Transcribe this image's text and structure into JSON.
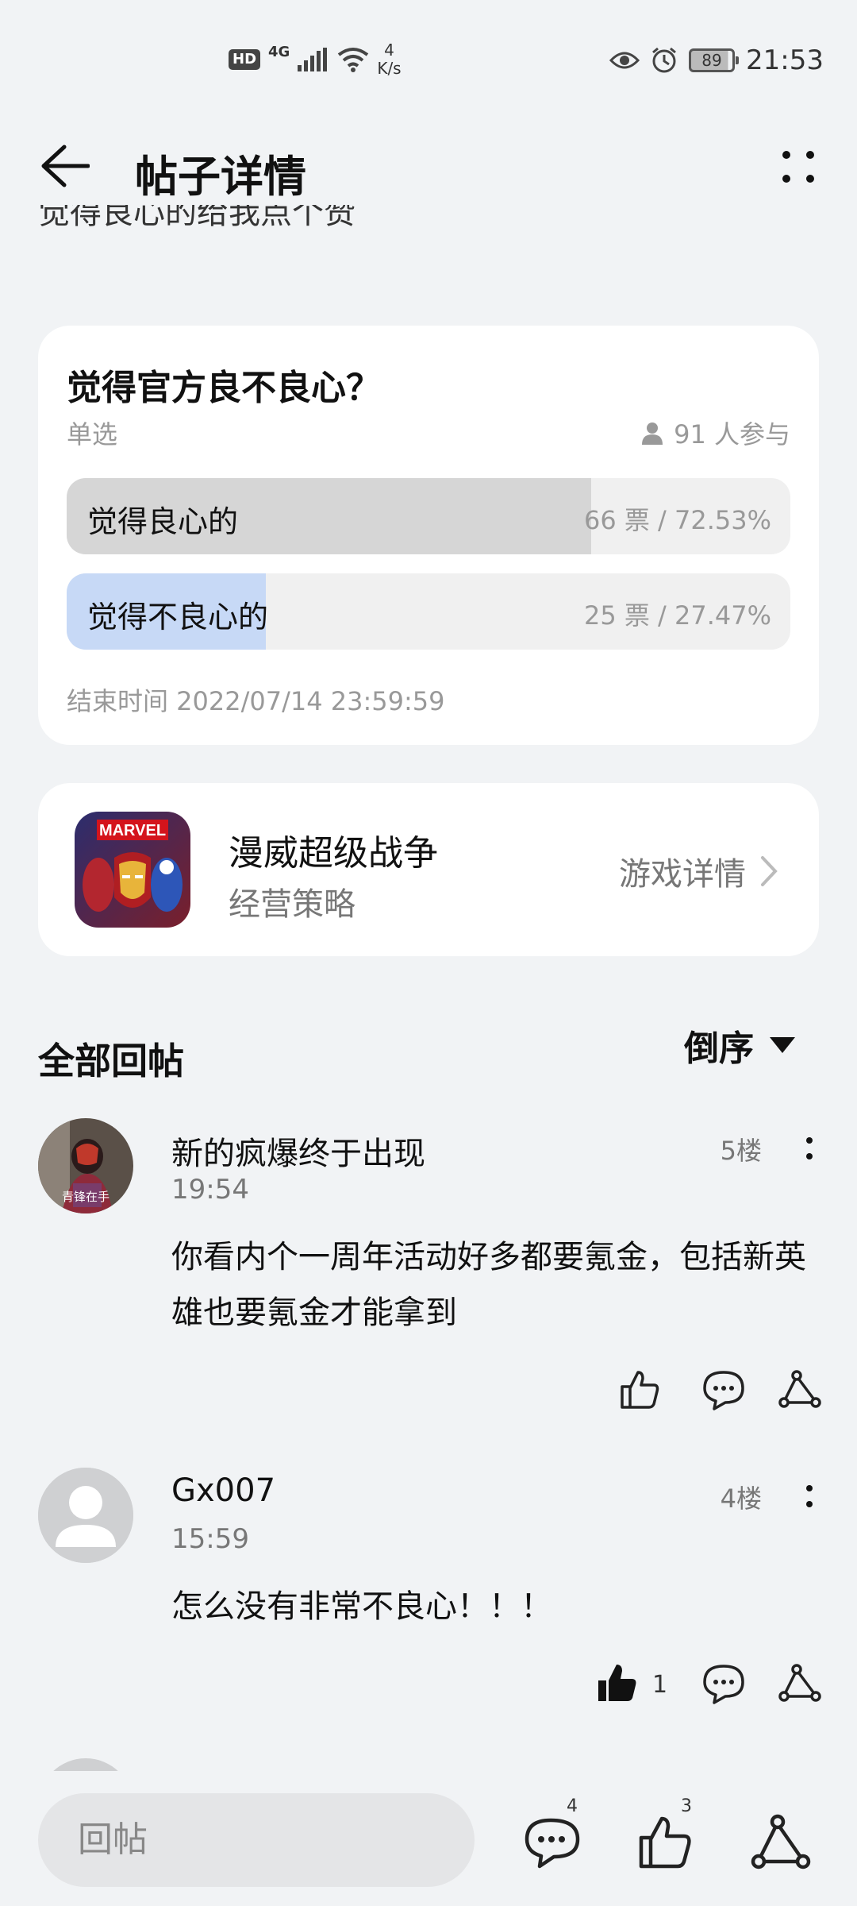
{
  "status_bar": {
    "hd": "HD",
    "network": "4G",
    "speed_value": "4",
    "speed_unit": "K/s",
    "battery": "89",
    "time": "21:53"
  },
  "header": {
    "title": "帖子详情"
  },
  "post": {
    "clipped_text": "觉得良心的给我点个赞"
  },
  "poll": {
    "question": "觉得官方良不良心？",
    "type": "单选",
    "participants": "91 人参与",
    "options": [
      {
        "label": "觉得良心的",
        "result": "66 票 / 72.53%",
        "fraction": 0.7253,
        "fill_color": "#d6d6d6"
      },
      {
        "label": "觉得不良心的",
        "result": "25 票 / 27.47%",
        "fraction": 0.2747,
        "fill_color": "#c7d9f6"
      }
    ],
    "end_time": "结束时间 2022/07/14 23:59:59"
  },
  "game": {
    "name": "漫威超级战争",
    "genre": "经营策略",
    "detail_label": "游戏详情",
    "icon_text": "MARVEL"
  },
  "replies": {
    "title": "全部回帖",
    "sort_label": "倒序",
    "items": [
      {
        "username": "新的疯爆终于出现",
        "floor": "5楼",
        "time": "19:54",
        "body": "你看内个一周年活动好多都要氪金，包括新英雄也要氪金才能拿到",
        "avatar_caption": "青锋在手",
        "likes": ""
      },
      {
        "username": "Gx007",
        "floor": "4楼",
        "time": "15:59",
        "body": "怎么没有非常不良心！！！",
        "likes": "1"
      }
    ]
  },
  "bottom_bar": {
    "reply_placeholder": "回帖",
    "comment_count": "4",
    "like_count": "3"
  }
}
